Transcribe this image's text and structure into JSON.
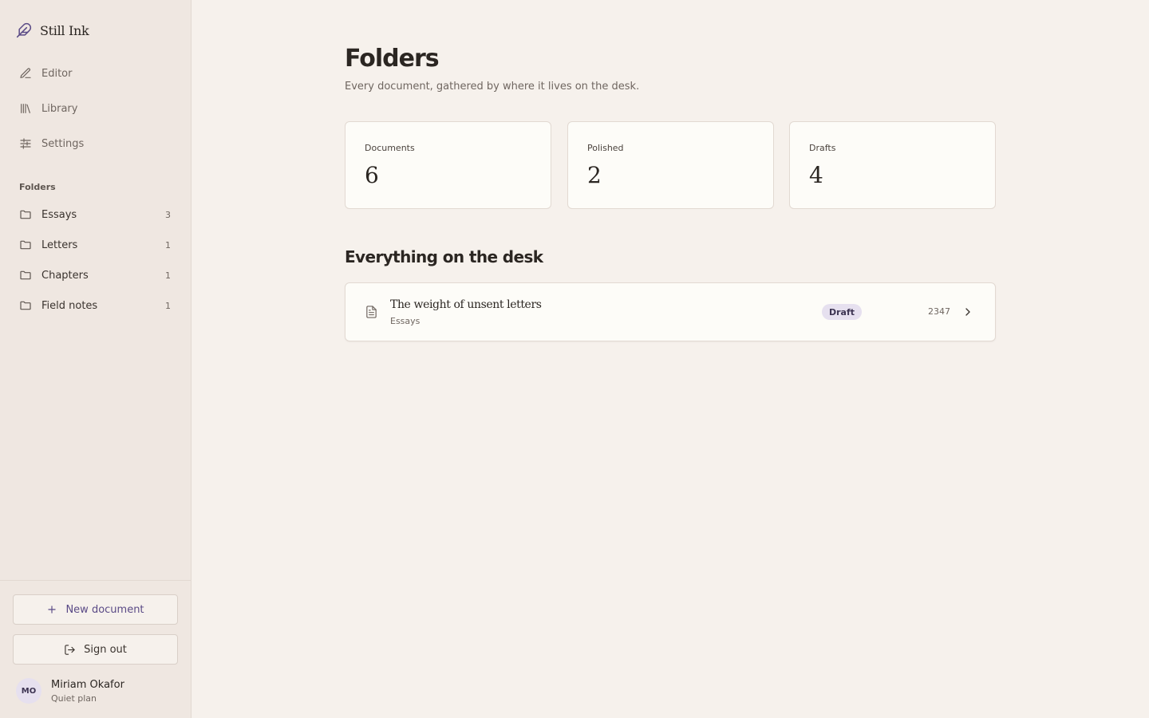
{
  "app": {
    "name": "Still Ink"
  },
  "nav": [
    {
      "label": "Editor",
      "icon": "pencil-icon"
    },
    {
      "label": "Library",
      "icon": "library-icon"
    },
    {
      "label": "Settings",
      "icon": "sliders-icon"
    }
  ],
  "folders": {
    "section_label": "Folders",
    "items": [
      {
        "label": "Essays",
        "count": "3"
      },
      {
        "label": "Letters",
        "count": "1"
      },
      {
        "label": "Chapters",
        "count": "1"
      },
      {
        "label": "Field notes",
        "count": "1"
      }
    ]
  },
  "actions": {
    "new_document": "New document",
    "sign_out": "Sign out"
  },
  "user": {
    "initials": "MO",
    "name": "Miriam Okafor",
    "plan": "Quiet plan"
  },
  "page": {
    "title": "Folders",
    "subtitle": "Every document, gathered by where it lives on the desk."
  },
  "stats": [
    {
      "label": "Documents",
      "value": "6"
    },
    {
      "label": "Polished",
      "value": "2"
    },
    {
      "label": "Drafts",
      "value": "4"
    }
  ],
  "section": {
    "title": "Everything on the desk"
  },
  "documents": [
    {
      "title": "The weight of unsent letters",
      "folder": "Essays",
      "status": "Draft",
      "words": "2347"
    }
  ],
  "colors": {
    "accent": "#5a4a86",
    "badge_bg": "#e6e0ef",
    "sidebar_bg": "#efe7e1",
    "page_bg": "#f6f1ec",
    "card_bg": "#fdfcf8"
  }
}
